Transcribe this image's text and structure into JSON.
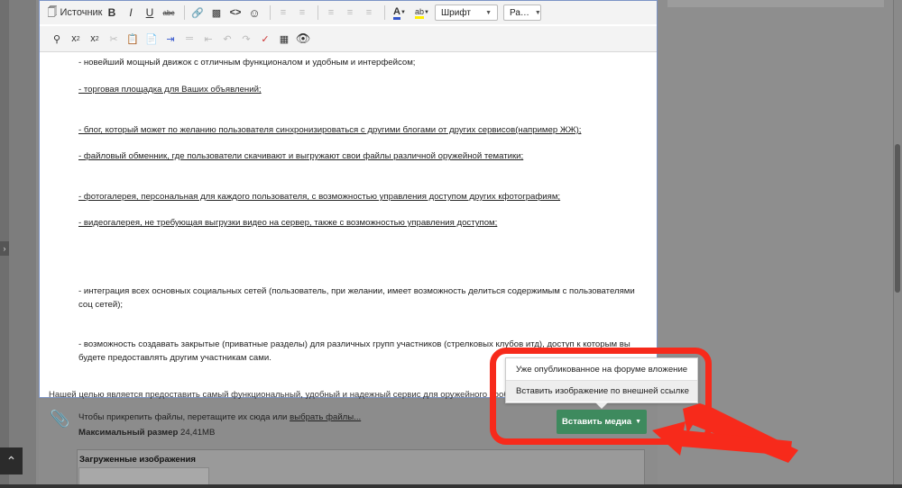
{
  "toolbar": {
    "source_label": "Источник",
    "bold": "B",
    "italic": "I",
    "underline": "U",
    "strike": "abc",
    "font_select": "Шрифт",
    "size_select": "Ра…",
    "subscript": "x",
    "superscript": "x"
  },
  "content": {
    "paragraphs": [
      "- новейший мощный движок с отличным функционалом и удобным и интерфейсом;",
      "- торговая площадка для Ваших объявлений;",
      "- блог, который может по желанию пользователя синхронизироваться с другими блогами от других сервисов(например ЖЖ);",
      "- файловый обменник, где пользователи скачивают и выгружают свои файлы различной оружейной тематики;",
      "- фотогалерея, персональная для каждого пользователя, с возможностью управления доступом других кфотографиям;",
      "- видеогалерея, не требующая выгрузки видео на сервер, также с возможностью управления доступом;",
      "- интеграция всех основных социальных сетей (пользователь, при желании, имеет возможность делиться содержимым с пользователями соц сетей);",
      "- возможность создавать закрытые (приватные разделы) для различных групп участников (стрелковых клубов итд), доступ к которым вы будете предоставлять другим участникам сами."
    ],
    "outside_text": "Нашей целью является предоставить самый функциональный, удобный и надежный сервис для оружейного сообщества"
  },
  "attachments": {
    "hint_prefix": "Чтобы прикрепить файлы, перетащите их сюда или ",
    "hint_link": "выбрать файлы...",
    "max_size_label": "Максимальный размер",
    "max_size_value": "24,41MB",
    "uploads_title": "Загруженные изображения"
  },
  "insert_media": {
    "button_label": "Вставить медиа",
    "menu": [
      "Уже опубликованное на форуме вложение",
      "Вставить изображение по внешней ссылке"
    ]
  },
  "colors": {
    "annotation_red": "#f72a1b",
    "button_green": "#3e8a5e",
    "editor_border": "#7c94c6"
  }
}
